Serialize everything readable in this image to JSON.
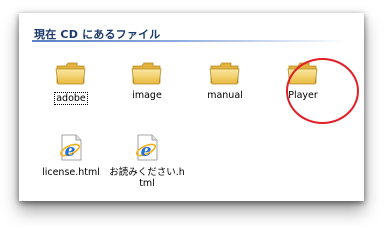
{
  "window": {
    "section_title": "現在 CD にあるファイル"
  },
  "items": [
    {
      "label": "adobe",
      "icon": "folder-icon"
    },
    {
      "label": "image",
      "icon": "folder-icon"
    },
    {
      "label": "manual",
      "icon": "folder-icon"
    },
    {
      "label": "Player",
      "icon": "folder-icon"
    },
    {
      "label": "license.html",
      "icon": "ie-html-icon"
    },
    {
      "label": "お読みください.html",
      "icon": "ie-html-icon"
    }
  ],
  "annotation": {
    "color": "#e01f26"
  },
  "colors": {
    "title": "#1b3a6b",
    "rule": "#5b7fc2",
    "folder": "#f3d56f"
  }
}
